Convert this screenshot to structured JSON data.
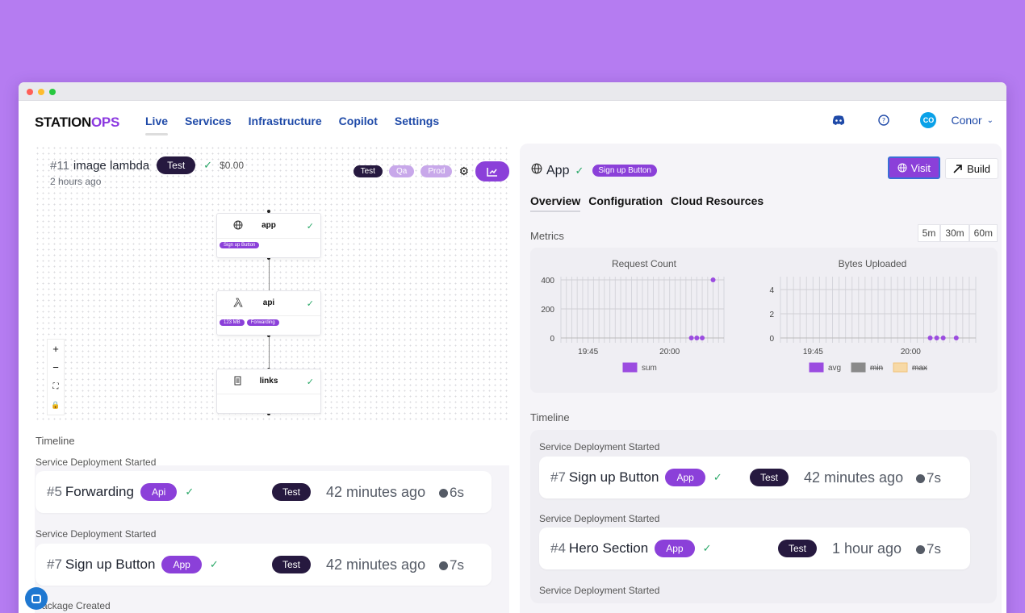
{
  "app": {
    "logo_main": "STATION",
    "logo_accent": "OPS",
    "nav": [
      "Live",
      "Services",
      "Infrastructure",
      "Copilot",
      "Settings"
    ],
    "user": {
      "initials": "CO",
      "name": "Conor"
    }
  },
  "left": {
    "service": {
      "number": "#11",
      "name": "image lambda",
      "env": "Test",
      "cost": "$0.00",
      "ago": "2 hours ago"
    },
    "envs": [
      "Test",
      "Qa",
      "Prod"
    ],
    "nodes": [
      {
        "name": "app",
        "tags": [
          "Sign up Button"
        ],
        "icon": "globe-icon"
      },
      {
        "name": "api",
        "tags": [
          "123 MB",
          "Forwarding"
        ],
        "icon": "lambda-icon"
      },
      {
        "name": "links",
        "tags": [],
        "icon": "document-icon"
      }
    ],
    "zoom": {
      "in": "+",
      "out": "−",
      "fit": "⛶",
      "lock": "🔒"
    },
    "timeline_label": "Timeline",
    "events": [
      {
        "label": "Service Deployment Started",
        "number": "#5",
        "name": "Forwarding",
        "service": "Api",
        "env": "Test",
        "time": "42 minutes ago",
        "duration": "6s"
      },
      {
        "label": "Service Deployment Started",
        "number": "#7",
        "name": "Sign up Button",
        "service": "App",
        "env": "Test",
        "time": "42 minutes ago",
        "duration": "7s"
      },
      {
        "label": "Package Created"
      }
    ]
  },
  "right": {
    "service_name": "App",
    "tag": "Sign up Button",
    "visit": "Visit",
    "build": "Build",
    "tabs": [
      "Overview",
      "Configuration",
      "Cloud Resources"
    ],
    "metrics_label": "Metrics",
    "ranges": [
      "5m",
      "30m",
      "60m"
    ],
    "timeline_label": "Timeline",
    "events": [
      {
        "label": "Service Deployment Started",
        "number": "#7",
        "name": "Sign up Button",
        "service": "App",
        "env": "Test",
        "time": "42 minutes ago",
        "duration": "7s"
      },
      {
        "label": "Service Deployment Started",
        "number": "#4",
        "name": "Hero Section",
        "service": "App",
        "env": "Test",
        "time": "1 hour ago",
        "duration": "7s"
      },
      {
        "label": "Service Deployment Started"
      }
    ]
  },
  "chart_data": [
    {
      "type": "scatter",
      "title": "Request Count",
      "x_ticks": [
        "19:45",
        "20:00"
      ],
      "y_ticks": [
        0,
        200,
        400
      ],
      "ylim": [
        0,
        400
      ],
      "series": [
        {
          "name": "sum",
          "color": "#9b4ce0",
          "points": [
            [
              "20:04",
              0
            ],
            [
              "20:05",
              0
            ],
            [
              "20:06",
              0
            ],
            [
              "20:08",
              400
            ]
          ]
        }
      ],
      "legend": "bottom"
    },
    {
      "type": "scatter",
      "title": "Bytes Uploaded",
      "x_ticks": [
        "19:45",
        "20:00"
      ],
      "y_ticks": [
        0,
        2,
        4
      ],
      "ylim": [
        0,
        4.8
      ],
      "series": [
        {
          "name": "avg",
          "color": "#9b4ce0",
          "points": [
            [
              "20:03",
              0
            ],
            [
              "20:04",
              0
            ],
            [
              "20:05",
              0
            ],
            [
              "20:07",
              0
            ]
          ]
        },
        {
          "name": "min",
          "color": "#8a8a8a",
          "points": []
        },
        {
          "name": "max",
          "color": "#f7d9a6",
          "points": []
        }
      ],
      "legend": "bottom"
    }
  ]
}
